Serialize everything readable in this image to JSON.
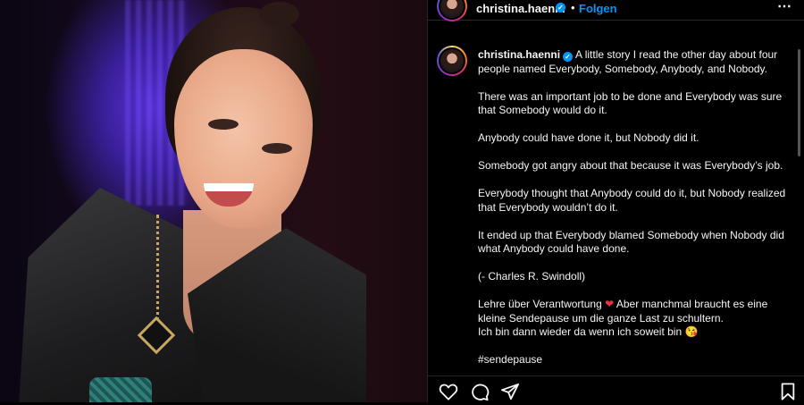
{
  "post": {
    "author": "christina.haenni",
    "verified_mark": "✓",
    "follow_label": "Folgen",
    "separator": "•",
    "more_label": "⋯",
    "caption": {
      "first_line": "A little story I read the other day about four people named Everybody, Somebody, Anybody, and Nobody.",
      "paragraphs": [
        "There was an important job to be done and Everybody was sure that Somebody would do it.",
        "Anybody could have done it, but Nobody did it.",
        "Somebody got angry about that because it was Everybody’s job.",
        "Everybody thought that Anybody could do it, but Nobody realized that Everybody wouldn’t do it.",
        "It ended up that Everybody blamed Somebody when Nobody did what Anybody could have done.",
        "(- Charles R. Swindoll)"
      ],
      "german_line1": "Lehre über Verantwortung",
      "heart": "❤",
      "german_line1b": "Aber manchmal braucht es eine kleine Sendepause um die ganze Last zu schultern.",
      "german_line2": "Ich bin dann wieder da wenn ich soweit bin",
      "emoji": "😘",
      "hashtag": "#sendepause"
    }
  },
  "icons": {
    "like": "heart-icon",
    "comment": "comment-icon",
    "share": "share-icon",
    "save": "bookmark-icon",
    "verified": "verified-badge-icon",
    "more": "more-options-icon"
  },
  "colors": {
    "link_blue": "#0095f6",
    "verified_blue": "#0095f6",
    "heart_red": "#ed2f44",
    "background": "#000000"
  }
}
